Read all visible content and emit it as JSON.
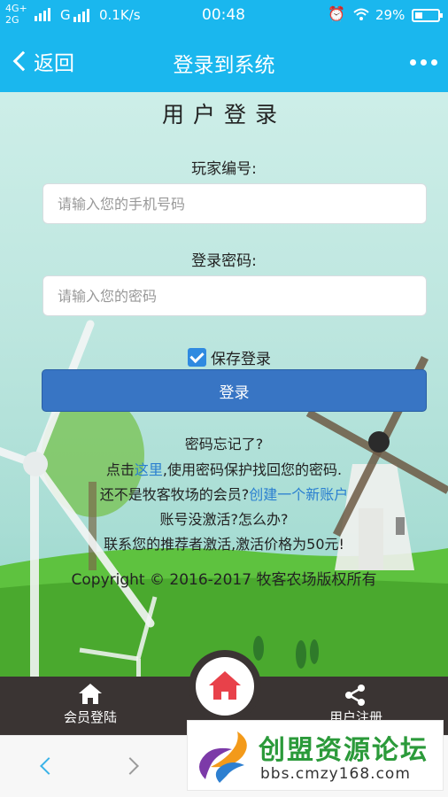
{
  "status_bar": {
    "network_top": "4G+",
    "network_bottom": "2G",
    "network_g": "G",
    "speed": "0.1K/s",
    "time": "00:48",
    "battery": "29%"
  },
  "nav": {
    "back_label": "返回",
    "title": "登录到系统"
  },
  "form": {
    "heading": "用户登录",
    "player_id_label": "玩家编号:",
    "player_id_placeholder": "请输入您的手机号码",
    "password_label": "登录密码:",
    "password_placeholder": "请输入您的密码",
    "remember_label": "保存登录",
    "remember_checked": true,
    "login_button": "登录"
  },
  "help": {
    "forgot_title": "密码忘记了?",
    "forgot_prefix": "点击",
    "forgot_link": "这里",
    "forgot_suffix": ",使用密码保护找回您的密码.",
    "register_prefix": "还不是牧客牧场的会员?",
    "register_link": "创建一个新账户",
    "activate_question": "账号没激活?怎么办?",
    "activate_answer": "联系您的推荐者激活,激活价格为50元!",
    "copyright": "Copyright © 2016-2017 牧客农场版权所有"
  },
  "tabbar": {
    "left_label": "会员登陆",
    "right_label": "用户注册"
  },
  "watermark": {
    "name": "创盟资源论坛",
    "url": "bbs.cmzy168.com"
  },
  "colors": {
    "header": "#1ab7ee",
    "button": "#3875c4",
    "tabbar": "#3a3433",
    "home_icon": "#e8414a"
  }
}
